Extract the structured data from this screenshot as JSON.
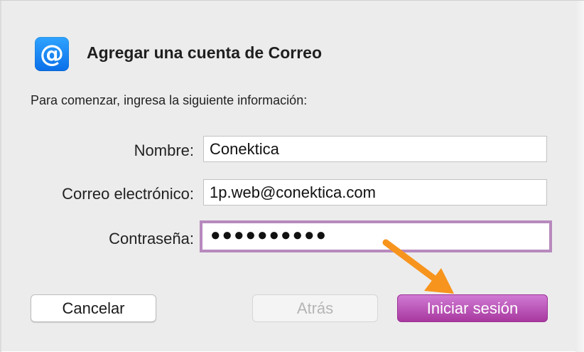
{
  "dialog": {
    "title": "Agregar una cuenta de Correo",
    "intro": "Para comenzar, ingresa la siguiente información:",
    "app_icon_glyph": "@",
    "accent_color": "#b789bd"
  },
  "form": {
    "name_label": "Nombre:",
    "name_value": "Conektica",
    "email_label": "Correo electrónico:",
    "email_value": "1p.web@conektica.com",
    "password_label": "Contraseña:",
    "password_value": "●●●●●●●●●●"
  },
  "buttons": {
    "cancel": "Cancelar",
    "back": "Atrás",
    "login": "Iniciar sesión"
  },
  "annotation": {
    "arrow_color": "#f7941d"
  }
}
